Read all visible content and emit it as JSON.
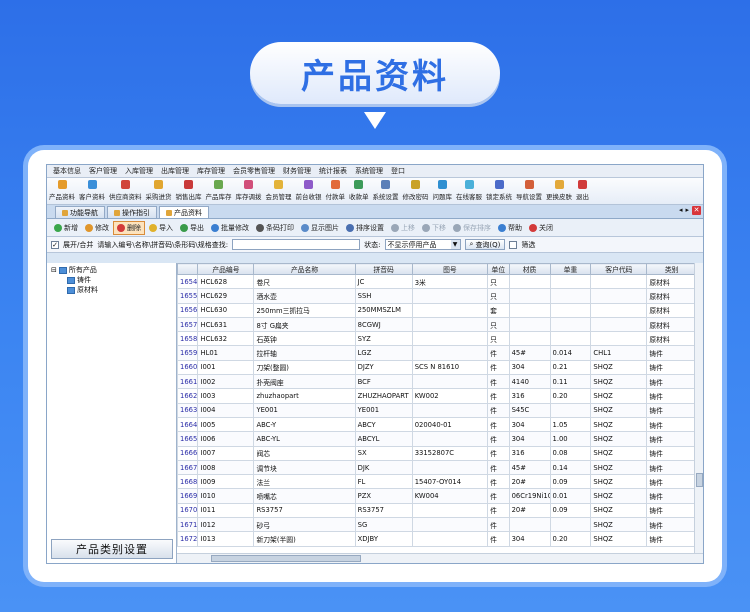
{
  "hero": {
    "title": "产品资料"
  },
  "menu": [
    "基本信息",
    "客户管理",
    "入库管理",
    "出库管理",
    "库存管理",
    "会员零售管理",
    "财务管理",
    "统计报表",
    "系统管理",
    "登口"
  ],
  "toolbar": [
    {
      "label": "产品资料",
      "color": "#e59b2b"
    },
    {
      "label": "客户资料",
      "color": "#3b8fd9"
    },
    {
      "label": "供应商资料",
      "color": "#d1453b"
    },
    {
      "label": "采购进货",
      "color": "#e1a630"
    },
    {
      "label": "销售出库",
      "color": "#c93a3a"
    },
    {
      "label": "产品库存",
      "color": "#6aa84f"
    },
    {
      "label": "库存调拨",
      "color": "#d14f7a"
    },
    {
      "label": "会员管理",
      "color": "#e3b33a"
    },
    {
      "label": "前台收银",
      "color": "#8e5bc9"
    },
    {
      "label": "付款单",
      "color": "#e26a3a"
    },
    {
      "label": "收款单",
      "color": "#3d9b5a"
    },
    {
      "label": "系统设置",
      "color": "#5b7fb8"
    },
    {
      "label": "修改密码",
      "color": "#c9a227"
    },
    {
      "label": "问题库",
      "color": "#2f8fd1"
    },
    {
      "label": "在线客服",
      "color": "#4bb0d9"
    },
    {
      "label": "锁定系统",
      "color": "#4c6bc9"
    },
    {
      "label": "导航设置",
      "color": "#d35f3a"
    },
    {
      "label": "更换皮肤",
      "color": "#e3a93a"
    },
    {
      "label": "退出",
      "color": "#d13b3b"
    }
  ],
  "tabs": [
    "功能导航",
    "操作指引",
    "产品资料"
  ],
  "tab_controls": {
    "prev": "◂",
    "next": "▸",
    "close": "✕"
  },
  "actions": [
    {
      "label": "新增",
      "color": "#3aa64a",
      "state": "normal"
    },
    {
      "label": "修改",
      "color": "#e0962b",
      "state": "normal"
    },
    {
      "label": "删除",
      "color": "#d33a3a",
      "state": "pressed"
    },
    {
      "label": "导入",
      "color": "#e0b12b",
      "state": "normal"
    },
    {
      "label": "导出",
      "color": "#3a9b4a",
      "state": "normal"
    },
    {
      "label": "批量修改",
      "color": "#3b7fd1",
      "state": "normal"
    },
    {
      "label": "条码打印",
      "color": "#555555",
      "state": "normal"
    },
    {
      "label": "显示图片",
      "color": "#5a8bc9",
      "state": "normal"
    },
    {
      "label": "排序设置",
      "color": "#4a6fb0",
      "state": "normal"
    },
    {
      "label": "上移",
      "color": "#9aa7b7",
      "state": "disabled"
    },
    {
      "label": "下移",
      "color": "#9aa7b7",
      "state": "disabled"
    },
    {
      "label": "保存排序",
      "color": "#9aa7b7",
      "state": "disabled"
    },
    {
      "label": "帮助",
      "color": "#3b7fd1",
      "state": "normal"
    },
    {
      "label": "关闭",
      "color": "#d33a3a",
      "state": "normal"
    }
  ],
  "search": {
    "expand_label": "展开/合并",
    "expand_checked": "✓",
    "hint": "请输入编号\\名称\\拼音码\\条形码\\规格查找:",
    "value": "",
    "status_label": "状态:",
    "status_value": "不显示停用产品",
    "query_label": "查询(Q)",
    "filter_label": "筛选"
  },
  "tree": {
    "root": "所有产品",
    "children": [
      "铸件",
      "原材料"
    ]
  },
  "category_button": "产品类别设置",
  "columns": [
    "产品编号",
    "产品名称",
    "拼音码",
    "图号",
    "单位",
    "材质",
    "单重",
    "客户代码",
    "类别"
  ],
  "rows": [
    [
      "1654",
      "HCL628",
      "卷尺",
      "JC",
      "3米",
      "只",
      "",
      "",
      "",
      "原材料"
    ],
    [
      "1655",
      "HCL629",
      "酒水壶",
      "SSH",
      "",
      "只",
      "",
      "",
      "",
      "原材料"
    ],
    [
      "1656",
      "HCL630",
      "250mm三抓拉马",
      "250MMSZLM",
      "",
      "套",
      "",
      "",
      "",
      "原材料"
    ],
    [
      "1657",
      "HCL631",
      "8寸 G扁夹",
      "8CGWJ",
      "",
      "只",
      "",
      "",
      "",
      "原材料"
    ],
    [
      "1658",
      "HCL632",
      "石英钟",
      "SYZ",
      "",
      "只",
      "",
      "",
      "",
      "原材料"
    ],
    [
      "1659",
      "HL01",
      "拉杆轴",
      "LGZ",
      "",
      "件",
      "45#",
      "0.014",
      "CHL1",
      "铸件"
    ],
    [
      "1660",
      "I001",
      "刀架(整圆)",
      "DJZY",
      "SCS N 81610",
      "件",
      "304",
      "0.21",
      "SHQZ",
      "铸件"
    ],
    [
      "1661",
      "I002",
      "扑壳阀座",
      "BCF",
      "",
      "件",
      "4140",
      "0.11",
      "SHQZ",
      "铸件"
    ],
    [
      "1662",
      "I003",
      "zhuzhaopart",
      "ZHUZHAOPART",
      "KW002",
      "件",
      "316",
      "0.20",
      "SHQZ",
      "铸件"
    ],
    [
      "1663",
      "I004",
      "YE001",
      "YE001",
      "",
      "件",
      "S45C",
      "",
      "SHQZ",
      "铸件"
    ],
    [
      "1664",
      "I005",
      "ABC-Y",
      "ABCY",
      "020040-01",
      "件",
      "304",
      "1.05",
      "SHQZ",
      "铸件"
    ],
    [
      "1665",
      "I006",
      "ABC-YL",
      "ABCYL",
      "",
      "件",
      "304",
      "1.00",
      "SHQZ",
      "铸件"
    ],
    [
      "1666",
      "I007",
      "阀芯",
      "SX",
      "33152807C",
      "件",
      "316",
      "0.08",
      "SHQZ",
      "铸件"
    ],
    [
      "1667",
      "I008",
      "调节块",
      "DJK",
      "",
      "件",
      "45#",
      "0.14",
      "SHQZ",
      "铸件"
    ],
    [
      "1668",
      "I009",
      "法兰",
      "FL",
      "15407-OY014",
      "件",
      "20#",
      "0.09",
      "SHQZ",
      "铸件"
    ],
    [
      "1669",
      "I010",
      "喷嘴芯",
      "PZX",
      "KW004",
      "件",
      "06Cr19Ni10",
      "0.01",
      "SHQZ",
      "铸件"
    ],
    [
      "1670",
      "I011",
      "RS3757",
      "RS3757",
      "",
      "件",
      "20#",
      "0.09",
      "SHQZ",
      "铸件"
    ],
    [
      "1671",
      "I012",
      "砂弓",
      "SG",
      "",
      "件",
      "",
      "",
      "SHQZ",
      "铸件"
    ],
    [
      "1672",
      "I013",
      "新刀架(半圆)",
      "XDJBY",
      "",
      "件",
      "304",
      "0.20",
      "SHQZ",
      "铸件"
    ]
  ],
  "colors": {
    "background": "#3c85f2",
    "title": "#2f6fe4",
    "accent_border": "#7fb2fa"
  }
}
